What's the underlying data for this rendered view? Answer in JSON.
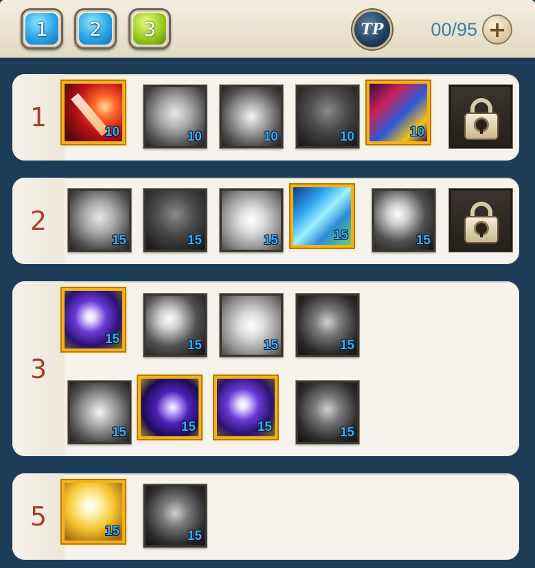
{
  "header": {
    "tabs": [
      {
        "label": "1",
        "color": "#29a5e6"
      },
      {
        "label": "2",
        "color": "#29a5e6"
      },
      {
        "label": "3",
        "color": "#9acb1e",
        "selected": true
      }
    ],
    "tp_label": "TP",
    "tp_count": "00/95",
    "add_icon": "plus-icon"
  },
  "tiers": [
    {
      "label": "1",
      "skills": [
        {
          "level": "10",
          "learned": true,
          "icon": "red-slash-skill-icon"
        },
        {
          "level": "10",
          "learned": false,
          "icon": "armored-torso-skill-icon"
        },
        {
          "level": "10",
          "learned": false,
          "icon": "armor-burst-skill-icon"
        },
        {
          "level": "10",
          "learned": false,
          "icon": "aura-body-skill-icon"
        },
        {
          "level": "10",
          "learned": true,
          "icon": "shield-strike-skill-icon"
        },
        {
          "locked": true,
          "icon": "lock-icon"
        }
      ]
    },
    {
      "label": "2",
      "skills": [
        {
          "level": "15",
          "learned": false,
          "icon": "afterimage-skill-icon"
        },
        {
          "level": "15",
          "learned": false,
          "icon": "shadow-cloak-skill-icon"
        },
        {
          "level": "15",
          "learned": false,
          "icon": "crystal-shield-skill-icon"
        },
        {
          "level": "15",
          "learned": true,
          "icon": "ice-crystal-skill-icon"
        },
        {
          "level": "15",
          "learned": false,
          "icon": "light-pillar-skill-icon"
        },
        {
          "locked": true,
          "icon": "lock-icon"
        }
      ]
    },
    {
      "label": "3",
      "skills": [
        {
          "level": "15",
          "learned": true,
          "icon": "violet-burst-skill-icon"
        },
        {
          "level": "15",
          "learned": false,
          "icon": "dark-burst-skill-icon"
        },
        {
          "level": "15",
          "learned": false,
          "icon": "wing-slash-skill-icon"
        },
        {
          "level": "15",
          "learned": false,
          "icon": "dark-wing-skill-icon"
        },
        {
          "level": "15",
          "learned": false,
          "icon": "crowd-skill-icon"
        },
        {
          "level": "15",
          "learned": true,
          "icon": "summoner-skill-icon"
        },
        {
          "level": "15",
          "learned": true,
          "icon": "star-burst-skill-icon"
        },
        {
          "level": "15",
          "learned": false,
          "icon": "shadow-strike-skill-icon"
        }
      ]
    },
    {
      "label": "5",
      "skills": [
        {
          "level": "15",
          "learned": true,
          "icon": "golden-light-skill-icon"
        },
        {
          "level": "15",
          "learned": false,
          "icon": "glowing-eyes-skill-icon"
        }
      ]
    }
  ],
  "colors": {
    "learned_border": "#f3b21c",
    "level_text": "#39a9f2",
    "tier_number": "#b03c2c",
    "tp_text": "#3f7ea8"
  }
}
